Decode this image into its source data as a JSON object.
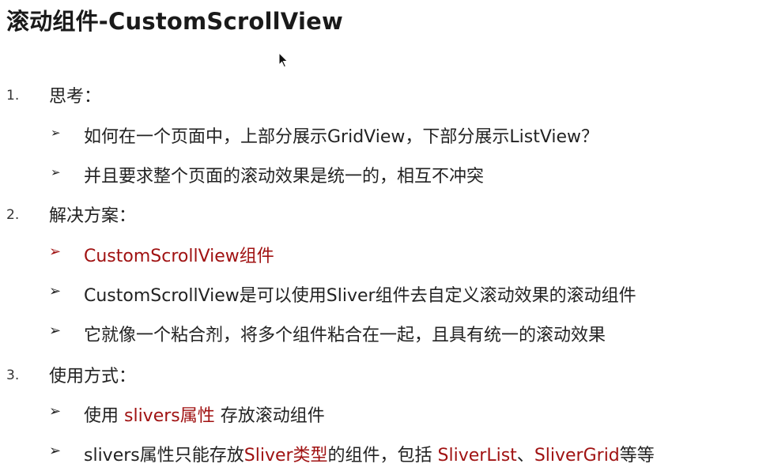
{
  "slide": {
    "title": "滚动组件-CustomScrollView",
    "sections": [
      {
        "number": "1.",
        "heading": "思考：",
        "bullets": [
          "如何在一个页面中，上部分展示GridView，下部分展示ListView？",
          "并且要求整个页面的滚动效果是统一的，相互不冲突"
        ]
      },
      {
        "number": "2.",
        "heading": "解决方案：",
        "bullets": [
          "CustomScrollView组件",
          "CustomScrollView是可以使用Sliver组件去自定义滚动效果的滚动组件",
          "它就像一个粘合剂，将多个组件粘合在一起，且具有统一的滚动效果"
        ]
      },
      {
        "number": "3.",
        "heading": "使用方式：",
        "bullets": [
          {
            "parts": [
              "使用 ",
              "slivers属性",
              " 存放滚动组件"
            ]
          },
          {
            "parts": [
              "slivers属性只能存放",
              "Sliver类型",
              "的组件，包括 ",
              "SliverList",
              "、",
              "SliverGrid",
              "等等"
            ]
          }
        ]
      }
    ],
    "bullet_marker": "➢",
    "colors": {
      "text": "#222222",
      "accent": "#a01212"
    }
  }
}
